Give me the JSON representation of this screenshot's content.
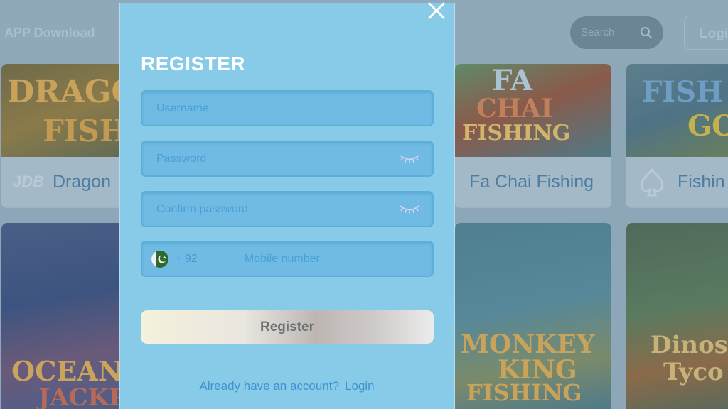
{
  "topbar": {
    "app_download_label": "APP Download",
    "search_placeholder": "Search",
    "login_label": "Logi"
  },
  "games": [
    {
      "thumb_text_1": "DRAGO",
      "thumb_text_2": "FISH",
      "title": "Dragon",
      "provider": "JDB"
    },
    {
      "thumb_text_1": "FA",
      "thumb_text_2": "CHAI",
      "thumb_text_3": "FISHING",
      "title": "Fa Chai Fishing"
    },
    {
      "thumb_text_1": "FISH",
      "thumb_text_2": "GO",
      "title": "Fishin"
    },
    {
      "thumb_text_1": "OCEAN K",
      "thumb_text_2": "JACKP"
    },
    {
      "thumb_text_1": "MONKEY",
      "thumb_text_2": "KING",
      "thumb_text_3": "FISHING"
    },
    {
      "thumb_text_1": "Dinos",
      "thumb_text_2": "Tyco"
    }
  ],
  "modal": {
    "title": "REGISTER",
    "username_placeholder": "Username",
    "password_placeholder": "Password",
    "confirm_password_placeholder": "Confirm password",
    "country_code": "+ 92",
    "mobile_placeholder": "Mobile number",
    "register_button_label": "Register",
    "footer_prompt": "Already have an account?",
    "login_link_label": "Login"
  },
  "icons": {
    "close": "close-icon",
    "eye": "eye-closed-icon",
    "flag": "pakistan-flag-icon",
    "search": "search-icon"
  },
  "colors": {
    "modal_background": "#87cbe9",
    "field_background": "#6fbbe4",
    "title_text": "#ffffff",
    "link_text": "#3e93d0"
  }
}
